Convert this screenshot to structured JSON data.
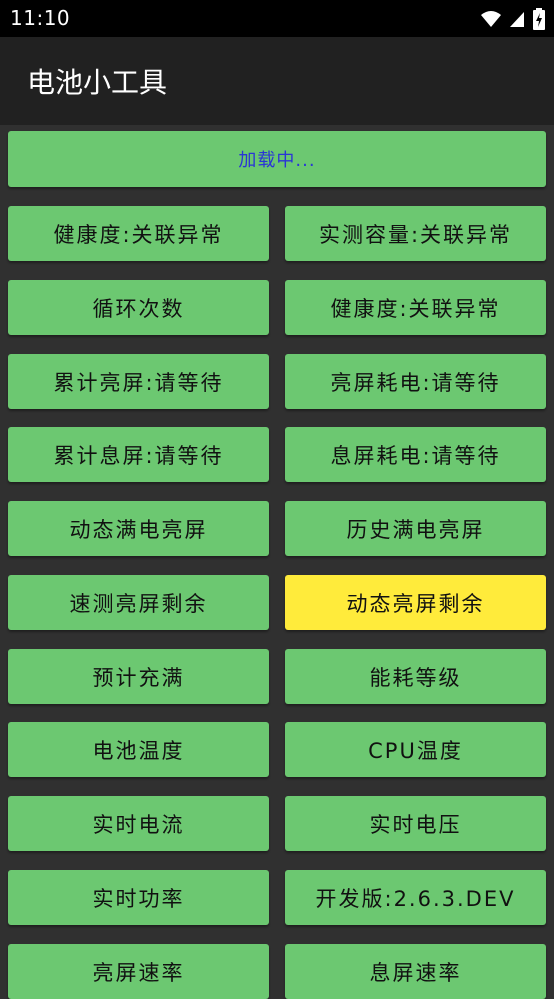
{
  "status_bar": {
    "time": "11:10",
    "icons": [
      "wifi-icon",
      "signal-icon",
      "battery-charging-icon"
    ]
  },
  "app_bar": {
    "title": "电池小工具"
  },
  "colors": {
    "button": "#6cc871",
    "highlight": "#ffeb3b",
    "loading_text": "#2a35d6"
  },
  "loading_label": "加载中...",
  "buttons": [
    {
      "left": "健康度:关联异常",
      "right": "实测容量:关联异常"
    },
    {
      "left": "循环次数",
      "right": "健康度:关联异常"
    },
    {
      "left": "累计亮屏:请等待",
      "right": "亮屏耗电:请等待"
    },
    {
      "left": "累计息屏:请等待",
      "right": "息屏耗电:请等待"
    },
    {
      "left": "动态满电亮屏",
      "right": "历史满电亮屏"
    },
    {
      "left": "速测亮屏剩余",
      "right": "动态亮屏剩余"
    },
    {
      "left": "预计充满",
      "right": "能耗等级"
    },
    {
      "left": "电池温度",
      "right": "CPU温度"
    },
    {
      "left": "实时电流",
      "right": "实时电压"
    },
    {
      "left": "实时功率",
      "right": "开发版:2.6.3.DEV"
    },
    {
      "left": "亮屏速率",
      "right": "息屏速率"
    }
  ]
}
